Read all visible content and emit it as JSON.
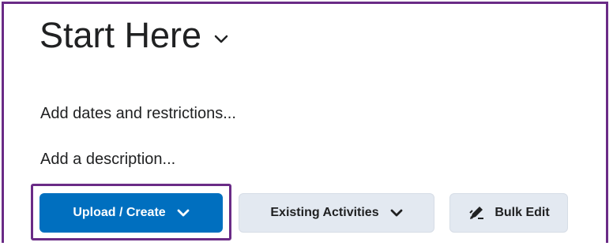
{
  "page": {
    "title": "Start Here"
  },
  "links": {
    "dates": "Add dates and restrictions...",
    "description": "Add a description..."
  },
  "toolbar": {
    "upload_create_label": "Upload / Create",
    "existing_activities_label": "Existing Activities",
    "bulk_edit_label": "Bulk Edit"
  },
  "colors": {
    "highlight_frame": "#6a2b86",
    "primary_button": "#006fbf",
    "secondary_button": "#e3e9f1",
    "text": "#202122"
  },
  "icons": {
    "title_menu": "chevron-down-icon",
    "upload_menu": "chevron-down-icon",
    "existing_menu": "chevron-down-icon",
    "bulk_edit": "pencil-icon"
  }
}
